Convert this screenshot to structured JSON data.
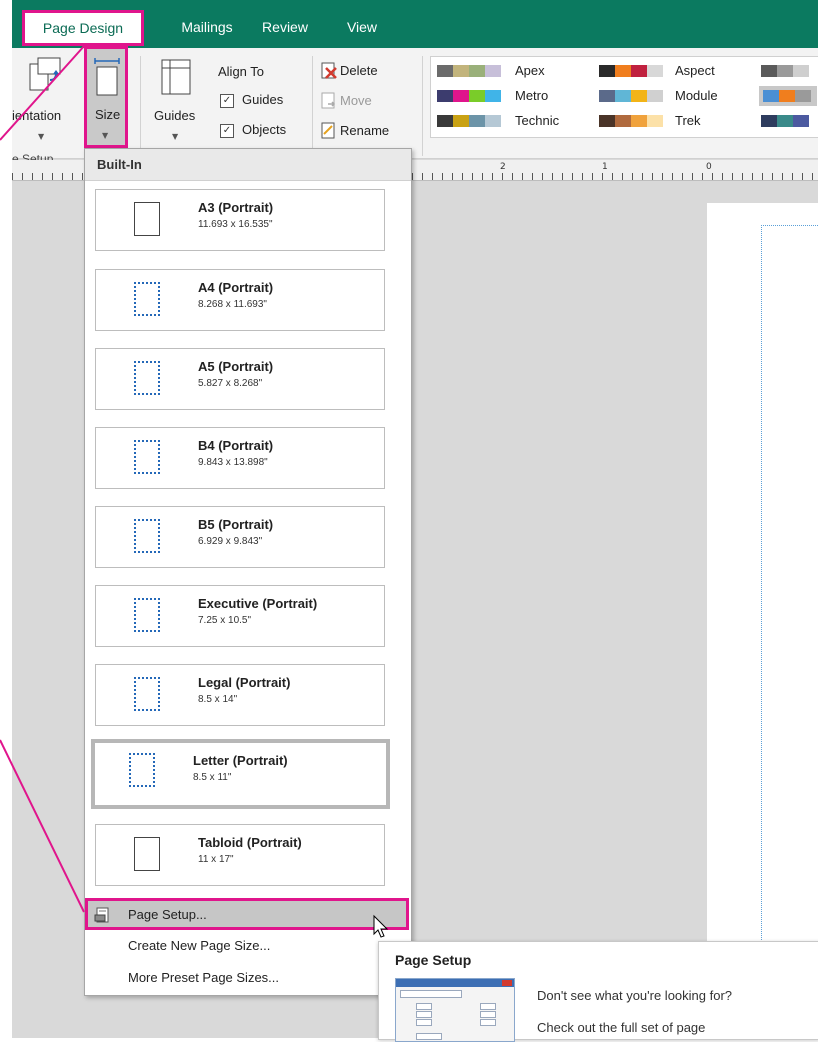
{
  "tabs": [
    {
      "label": "Page Design"
    },
    {
      "label": "Mailings"
    },
    {
      "label": "Review"
    },
    {
      "label": "View"
    }
  ],
  "ribbon": {
    "orientation_label": "ientation",
    "size_label": "Size",
    "guides_label": "Guides",
    "align_to_label": "Align To",
    "guides_check_label": "Guides",
    "objects_check_label": "Objects",
    "delete_label": "Delete",
    "move_label": "Move",
    "rename_label": "Rename",
    "group_label": "e Setup",
    "schemes": [
      {
        "name": "Apex",
        "colors": [
          "#6b6b6b",
          "#c2b47c",
          "#9ab07a",
          "#c7bfd9"
        ]
      },
      {
        "name": "Aspect",
        "colors": [
          "#2a2a2a",
          "#f07e1e",
          "#c0213f",
          "#d8d8d8"
        ]
      },
      {
        "name": "Metro",
        "colors": [
          "#3c3c6e",
          "#e0158c",
          "#7acc29",
          "#40b4e8"
        ]
      },
      {
        "name": "Module",
        "colors": [
          "#5b6a8a",
          "#60b6d6",
          "#f2b418",
          "#d0d0d0"
        ]
      },
      {
        "name": "Technic",
        "colors": [
          "#3a3a3a",
          "#c9a214",
          "#6c94a8",
          "#b5c8d5"
        ]
      },
      {
        "name": "Trek",
        "colors": [
          "#4a3428",
          "#b06a3e",
          "#f0a23c",
          "#fce1a8"
        ]
      }
    ]
  },
  "ruler": {
    "numbers": [
      "2",
      "1",
      "0"
    ]
  },
  "dropdown": {
    "header": "Built-In",
    "sizes": [
      {
        "name": "A3 (Portrait)",
        "dims": "11.693 x 16.535\"",
        "style": "plain"
      },
      {
        "name": "A4 (Portrait)",
        "dims": "8.268 x 11.693\"",
        "style": "dot"
      },
      {
        "name": "A5 (Portrait)",
        "dims": "5.827 x 8.268\"",
        "style": "dot"
      },
      {
        "name": "B4 (Portrait)",
        "dims": "9.843 x 13.898\"",
        "style": "dot"
      },
      {
        "name": "B5 (Portrait)",
        "dims": "6.929 x 9.843\"",
        "style": "dot"
      },
      {
        "name": "Executive (Portrait)",
        "dims": "7.25 x 10.5\"",
        "style": "dot"
      },
      {
        "name": "Legal (Portrait)",
        "dims": "8.5 x 14\"",
        "style": "dot"
      },
      {
        "name": "Letter (Portrait)",
        "dims": "8.5 x 11\"",
        "style": "dot",
        "selected": true
      },
      {
        "name": "Tabloid (Portrait)",
        "dims": "11 x 17\"",
        "style": "plain"
      }
    ],
    "menu": {
      "page_setup": "Page Setup...",
      "create_new": "Create New Page Size...",
      "more_preset": "More Preset Page Sizes..."
    }
  },
  "tooltip": {
    "title": "Page Setup",
    "line1": "Don't see what you're looking for?",
    "line2": "Check out the full set of page"
  },
  "colors": {
    "accent": "#0b7a60",
    "highlight": "#e0158c"
  }
}
